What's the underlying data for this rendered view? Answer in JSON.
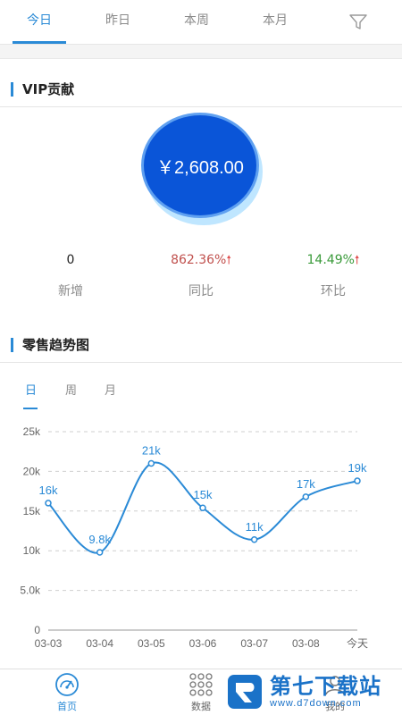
{
  "top_tabs": [
    {
      "label": "今日",
      "active": true
    },
    {
      "label": "昨日",
      "active": false
    },
    {
      "label": "本周",
      "active": false
    },
    {
      "label": "本月",
      "active": false
    }
  ],
  "vip_section": {
    "title": "VIP贡献",
    "amount": "￥2,608.00",
    "stats": [
      {
        "value": "0",
        "label": "新增",
        "color": "#222222"
      },
      {
        "value": "862.36%",
        "label": "同比",
        "color": "#c0504d",
        "trend": "up"
      },
      {
        "value": "14.49%",
        "label": "环比",
        "color": "#3a9a3a",
        "trend": "up"
      }
    ]
  },
  "sales_section": {
    "title": "零售趋势图",
    "tabs": [
      {
        "label": "日",
        "active": true
      },
      {
        "label": "周",
        "active": false
      },
      {
        "label": "月",
        "active": false
      }
    ]
  },
  "chart_data": {
    "type": "line",
    "categories": [
      "03-03",
      "03-04",
      "03-05",
      "03-06",
      "03-07",
      "03-08",
      "今天"
    ],
    "values": [
      16000,
      9800,
      21000,
      15400,
      11400,
      16800,
      18800
    ],
    "data_labels": [
      "16k",
      "9.8k",
      "21k",
      "15k",
      "11k",
      "17k",
      "19k"
    ],
    "y_ticks": [
      "0",
      "5.0k",
      "10k",
      "15k",
      "20k",
      "25k"
    ],
    "ylim": [
      0,
      25000
    ],
    "grid": true,
    "line_color": "#2a8ad6"
  },
  "bottom_nav": [
    {
      "label": "首页",
      "icon": "dashboard-icon",
      "active": true
    },
    {
      "label": "数据",
      "icon": "grid-dots-icon",
      "active": false
    },
    {
      "label": "我的",
      "icon": "user-icon",
      "active": false
    }
  ],
  "watermark": {
    "main": "第七下载站",
    "sub": "www.d7down.com"
  },
  "colors": {
    "accent": "#2a8ad6",
    "vip_circle": "#0a55d8"
  }
}
